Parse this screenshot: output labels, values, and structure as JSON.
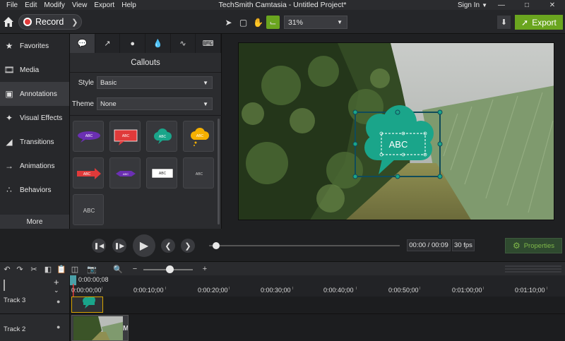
{
  "menubar": {
    "items": [
      "File",
      "Edit",
      "Modify",
      "View",
      "Export",
      "Help"
    ],
    "title": "TechSmith Camtasia - Untitled Project*",
    "sign_in": "Sign In"
  },
  "toolbar": {
    "record_label": "Record",
    "zoom_value": "31%",
    "export_label": "Export"
  },
  "sidebar": {
    "items": [
      {
        "label": "Favorites",
        "icon": "star-icon"
      },
      {
        "label": "Media",
        "icon": "film-icon"
      },
      {
        "label": "Annotations",
        "icon": "annotation-icon",
        "active": true
      },
      {
        "label": "Visual Effects",
        "icon": "effects-icon"
      },
      {
        "label": "Transitions",
        "icon": "transition-icon"
      },
      {
        "label": "Animations",
        "icon": "animation-icon"
      },
      {
        "label": "Behaviors",
        "icon": "behaviors-icon"
      }
    ],
    "more_label": "More"
  },
  "panel": {
    "title": "Callouts",
    "style_label": "Style",
    "style_value": "Basic",
    "theme_label": "Theme",
    "theme_value": "None",
    "tile_text": "ABC",
    "tabs": [
      "callout-tab-icon",
      "arrow-tab-icon",
      "shape-tab-icon",
      "blur-tab-icon",
      "sketch-tab-icon",
      "keystroke-tab-icon"
    ]
  },
  "canvas": {
    "callout_text": "ABC",
    "callout_color": "#1aa58a"
  },
  "playback": {
    "time": "00:00 / 00:09",
    "fps": "30 fps",
    "properties_label": "Properties"
  },
  "timeline": {
    "playhead_time": "0:00:00;08",
    "ticks": [
      "0:00:00;00",
      "0:00:10;00",
      "0:00:20;00",
      "0:00:30;00",
      "0:00:40;00",
      "0:00:50;00",
      "0:01:00;00",
      "0:01:10;00"
    ],
    "tracks": [
      "Track 3",
      "Track 2"
    ],
    "clip_m": "M"
  },
  "colors": {
    "accent_green": "#6aa51f",
    "record_red": "#e23b3b",
    "clip_outline": "#d9a400"
  }
}
